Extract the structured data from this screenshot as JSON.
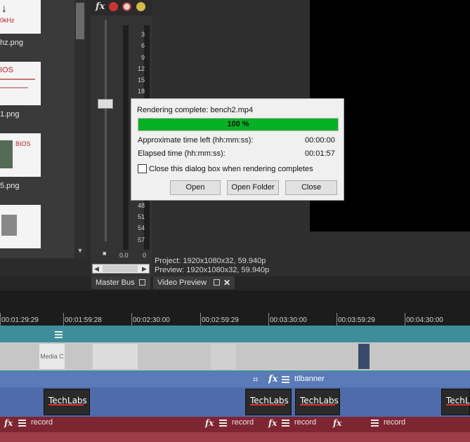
{
  "media_panel": {
    "items": [
      {
        "label": "hz.png",
        "thumb_text": "0kHz"
      },
      {
        "label": "1.png",
        "thumb_text": "IOS"
      },
      {
        "label": "5.png",
        "thumb_text": "BIOS"
      },
      {
        "label": "",
        "thumb_text": ""
      }
    ]
  },
  "master_bus": {
    "meter_ticks": [
      "3",
      "6",
      "9",
      "12",
      "15",
      "18",
      "48",
      "51",
      "54",
      "57"
    ],
    "readout_left": "0.0",
    "readout_right": "0"
  },
  "preview": {
    "project_line": "Project:  1920x1080x32, 59.940p",
    "preview_line": "Preview:  1920x1080x32, 59.940p"
  },
  "tabs": {
    "master_bus": "Master Bus",
    "video_preview": "Video Preview"
  },
  "timeline": {
    "ruler": [
      "00:01:29:29",
      "00:01:59:28",
      "00:02:30:00",
      "00:02:59:29",
      "00:03:30:00",
      "00:03:59:29",
      "00:04:30:00"
    ],
    "video_clip_label": "Media C",
    "title_track_label": "ttlbanner",
    "logo_text": "TechLabs",
    "audio_clip_label": "record"
  },
  "dialog": {
    "title": "Rendering complete: bench2.mp4",
    "progress_percent": 100,
    "progress_text": "100 %",
    "time_left_label": "Approximate time left (hh:mm:ss):",
    "time_left_value": "00:00:00",
    "elapsed_label": "Elapsed time (hh:mm:ss):",
    "elapsed_value": "00:01:57",
    "checkbox_label": "Close this dialog box when rendering completes",
    "checkbox_checked": false,
    "buttons": {
      "open": "Open",
      "open_folder": "Open Folder",
      "close": "Close"
    }
  },
  "colors": {
    "progress_green": "#06b025",
    "audio_track": "#7d2631",
    "video_track": "#3d8d9b",
    "title_track": "#5a7bb8"
  }
}
